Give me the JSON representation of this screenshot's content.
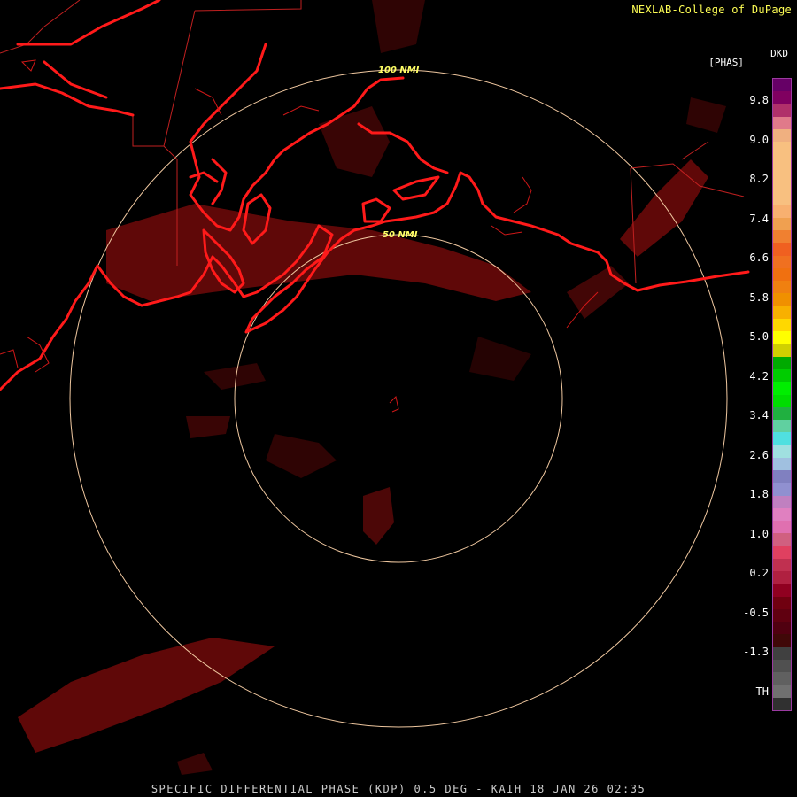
{
  "header": {
    "credit": "NEXLAB-College of DuPage",
    "product_code": "DKD",
    "units": "[PHAS]"
  },
  "footer": {
    "caption": "SPECIFIC DIFFERENTIAL PHASE (KDP) 0.5 DEG - KAIH 18 JAN 26 02:35"
  },
  "rings": {
    "inner_label": "50 NMI",
    "outer_label": "100 NMI"
  },
  "legend": {
    "ticks": [
      "9.8",
      "9.0",
      "8.2",
      "7.4",
      "6.6",
      "5.8",
      "5.0",
      "4.2",
      "3.4",
      "2.6",
      "1.8",
      "1.0",
      "0.2",
      "-0.5",
      "-1.3",
      "TH"
    ],
    "colors": [
      "#660066",
      "#800060",
      "#b0306a",
      "#e07a8a",
      "#f0b080",
      "#f8c080",
      "#f8c080",
      "#f8c080",
      "#f8c080",
      "#f8c080",
      "#f8b070",
      "#f0a050",
      "#f08030",
      "#f06020",
      "#f07020",
      "#f07010",
      "#f08010",
      "#f09000",
      "#f8b000",
      "#ffd800",
      "#ffff00",
      "#d0d000",
      "#00aa00",
      "#00cc00",
      "#00ee00",
      "#00dd00",
      "#20b040",
      "#60d0a0",
      "#50e0e0",
      "#a0e0e0",
      "#a0c0e0",
      "#8080c0",
      "#9090d0",
      "#c080c0",
      "#e080c0",
      "#e070b0",
      "#d06080",
      "#e04060",
      "#c03050",
      "#b02040",
      "#900020",
      "#700010",
      "#600010",
      "#500010",
      "#400808",
      "#404040",
      "#505050",
      "#606060",
      "#707070",
      "#303030"
    ]
  }
}
